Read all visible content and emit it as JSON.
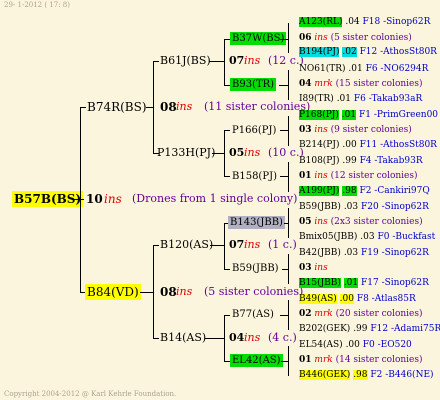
{
  "header": {
    "date": "29-  1-2012 ( 17:  8)"
  },
  "footer": {
    "copyright": "Copyright 2004-2012 @ Karl Kehrle Foundation."
  },
  "root": {
    "name": "B57B(BS)",
    "gen": "10",
    "ins": "ins",
    "note": "(Drones from 1 single colony)"
  },
  "gen1": [
    {
      "name": "B74R(BS)",
      "gen": "08",
      "ins": "ins",
      "note": "(11 sister colonies)"
    },
    {
      "name": "B84(VD)",
      "gen": "08",
      "ins": "ins",
      "note": "(5 sister colonies)"
    }
  ],
  "gen2": [
    {
      "name": "B61J(BS)",
      "gen": "07",
      "ins": "ins",
      "note": "(12 c.)"
    },
    {
      "name": "P133H(PJ)",
      "gen": "05",
      "ins": "ins",
      "note": "(10 c.)"
    },
    {
      "name": "B120(AS)",
      "gen": "07",
      "ins": "ins",
      "note": "(1 c.)"
    },
    {
      "name": "B14(AS)",
      "gen": "04",
      "ins": "ins",
      "note": "(4 c.)"
    }
  ],
  "gen3": [
    {
      "name": "B37W(BS)",
      "gen": "06",
      "ins": "ins",
      "note": "(5 sister colonies)"
    },
    {
      "name": "B93(TR)",
      "gen": "04",
      "ins": "mrk",
      "note": "(15 sister colonies)"
    },
    {
      "name": "P166(PJ)",
      "gen": "03",
      "ins": "ins",
      "note": "(9 sister colonies)"
    },
    {
      "name": "B158(PJ)",
      "gen": "01",
      "ins": "ins",
      "note": "(12 sister colonies)"
    },
    {
      "name": "B143(JBB)",
      "gen": "05",
      "ins": "ins",
      "note": "(2x3 sister colonies)"
    },
    {
      "name": "B59(JBB)",
      "gen": "03",
      "ins": "ins",
      "note": ""
    },
    {
      "name": "B77(AS)",
      "gen": "02",
      "ins": "mrk",
      "note": "(20 sister colonies)"
    },
    {
      "name": "EL42(AS)",
      "gen": "01",
      "ins": "mrk",
      "note": "(14 sister colonies)"
    }
  ],
  "gen4": [
    {
      "name": "A123(RL)",
      "val": ".04",
      "ref": "F18 -Sinop62R"
    },
    {
      "name": "B194(PJ)",
      "val": ".02",
      "ref": "F12 -AthosSt80R"
    },
    {
      "name": "NO61(TR)",
      "val": ".01",
      "ref": "F6 -NO6294R"
    },
    {
      "name": "I89(TR)",
      "val": ".01",
      "ref": "F6 -Takab93aR"
    },
    {
      "name": "P168(PJ)",
      "val": ".01",
      "ref": "F1 -PrimGreen00"
    },
    {
      "name": "B214(PJ)",
      "val": ".00",
      "ref": "F11 -AthosSt80R"
    },
    {
      "name": "B108(PJ)",
      "val": ".99",
      "ref": "F4 -Takab93R"
    },
    {
      "name": "A199(PJ)",
      "val": ".98",
      "ref": "F2 -Cankiri97Q"
    },
    {
      "name": "B59(JBB)",
      "val": ".03",
      "ref": "F20 -Sinop62R"
    },
    {
      "name": "Bmix05(JBB)",
      "val": ".03",
      "ref": "F0 -Buckfast"
    },
    {
      "name": "B42(JBB)",
      "val": ".03",
      "ref": "F19 -Sinop62R"
    },
    {
      "name": "B15(JBB)",
      "val": ".01",
      "ref": "F17 -Sinop62R"
    },
    {
      "name": "B49(AS)",
      "val": ".00",
      "ref": "F8 -Atlas85R"
    },
    {
      "name": "B202(GEK)",
      "val": ".99",
      "ref": "F12 -Adami75R"
    },
    {
      "name": "EL54(AS)",
      "val": ".00",
      "ref": "F0 -EO520"
    },
    {
      "name": "B446(GEK)",
      "val": ".98",
      "ref": "F2 -B446(NE)"
    }
  ],
  "colors": {
    "background": "#fbf5dd",
    "yellow": "#ffff00",
    "green": "#00dd00",
    "cyan": "#00dddd",
    "grey": "#b0b0c0",
    "blue": "#0000cc",
    "red": "#dd0000",
    "purple": "#660099"
  }
}
